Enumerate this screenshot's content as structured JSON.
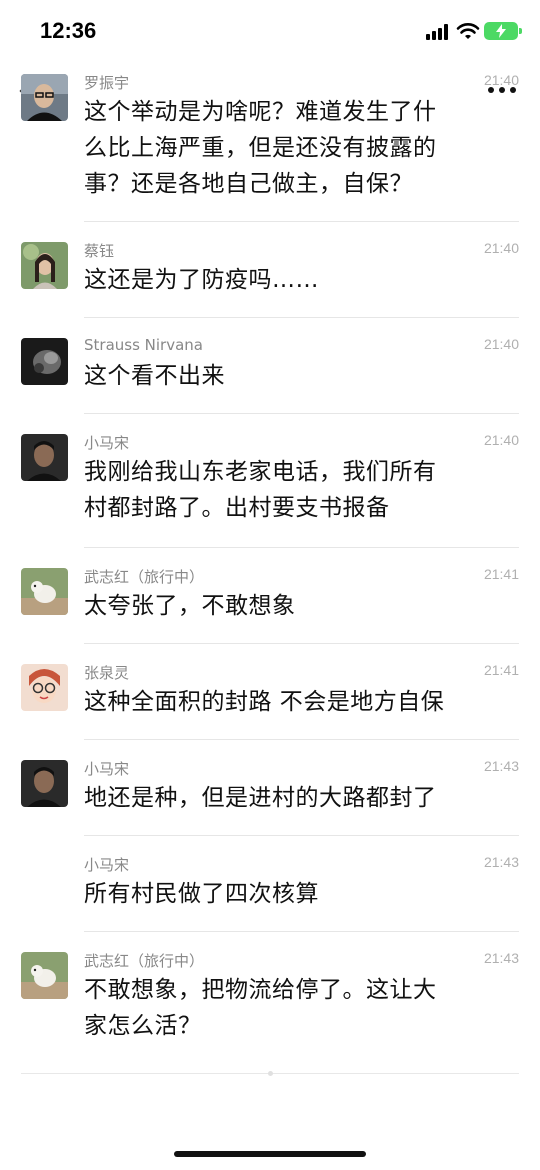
{
  "status_bar": {
    "time": "12:36"
  },
  "messages": [
    {
      "sender": "罗振宇",
      "time": "21:40",
      "lines": [
        "这个举动是为啥呢？难道发生了什",
        "么比上海严重，但是还没有披露的",
        "事？还是各地自己做主，自保？"
      ],
      "avatar": "man-glasses"
    },
    {
      "sender": "蔡钰",
      "time": "21:40",
      "lines": [
        "这还是为了防疫吗……"
      ],
      "avatar": "woman-garden"
    },
    {
      "sender": "Strauss Nirvana",
      "time": "21:40",
      "lines": [
        "这个看不出来"
      ],
      "avatar": "dark-animal"
    },
    {
      "sender": "小马宋",
      "time": "21:40",
      "lines": [
        "我刚给我山东老家电话，我们所有",
        "村都封路了。出村要支书报备"
      ],
      "avatar": "man-dark"
    },
    {
      "sender": "武志红（旅行中）",
      "time": "21:41",
      "lines": [
        "太夸张了，不敢想象"
      ],
      "avatar": "dog-photo"
    },
    {
      "sender": "张泉灵",
      "time": "21:41",
      "lines": [
        "这种全面积的封路 不会是地方自保"
      ],
      "avatar": "cartoon-woman-glasses"
    },
    {
      "sender": "小马宋",
      "time": "21:43",
      "lines": [
        "地还是种，但是进村的大路都封了"
      ],
      "avatar": "man-dark"
    },
    {
      "sender": "小马宋",
      "time": "21:43",
      "lines": [
        "所有村民做了四次核算"
      ],
      "avatar": ""
    },
    {
      "sender": "武志红（旅行中）",
      "time": "21:43",
      "lines": [
        "不敢想象，把物流给停了。这让大",
        "家怎么活？"
      ],
      "avatar": "dog-photo"
    }
  ]
}
